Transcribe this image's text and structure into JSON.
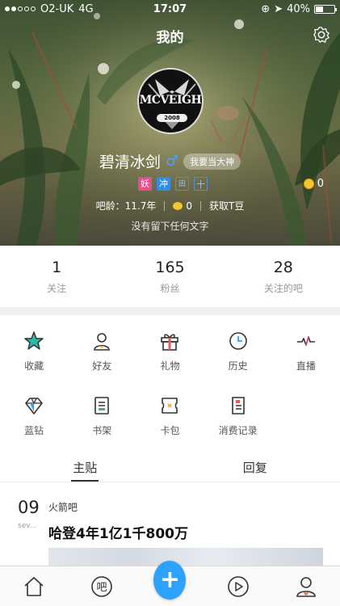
{
  "status_bar": {
    "carrier": "O2-UK",
    "network": "4G",
    "time": "17:07",
    "battery": "40%",
    "battery_level": 0.4
  },
  "header": {
    "title": "我的",
    "settings_icon": "settings-gear-icon"
  },
  "profile": {
    "avatar_text": "MCVEIGH",
    "avatar_year": "2008",
    "username": "碧清冰剑",
    "gender_symbol": "♂",
    "god_badge": "我要当大神",
    "medals": [
      "妖",
      "冲",
      "田",
      "十"
    ],
    "coin_count": "0",
    "bar_age": "吧龄：11.7年",
    "t_bean_count": "0",
    "get_t_bean": "获取T豆",
    "bio": "没有留下任何文字"
  },
  "stats": [
    {
      "value": "1",
      "label": "关注"
    },
    {
      "value": "165",
      "label": "粉丝"
    },
    {
      "value": "28",
      "label": "关注的吧"
    }
  ],
  "grid": [
    {
      "label": "收藏",
      "icon": "star-icon"
    },
    {
      "label": "好友",
      "icon": "friend-icon"
    },
    {
      "label": "礼物",
      "icon": "gift-icon"
    },
    {
      "label": "历史",
      "icon": "clock-icon"
    },
    {
      "label": "直播",
      "icon": "pulse-icon"
    },
    {
      "label": "蓝钻",
      "icon": "diamond-icon"
    },
    {
      "label": "书架",
      "icon": "bookshelf-icon"
    },
    {
      "label": "卡包",
      "icon": "card-icon"
    },
    {
      "label": "消费记录",
      "icon": "receipt-icon"
    }
  ],
  "tabs": [
    {
      "label": "主贴",
      "active": true
    },
    {
      "label": "回复",
      "active": false
    }
  ],
  "post": {
    "day": "09",
    "month": "sev...",
    "forum": "火箭吧",
    "title": "哈登4年1亿1千800万"
  },
  "bottom_nav": [
    {
      "name": "home",
      "icon": "home-icon"
    },
    {
      "name": "bar",
      "icon": "bar-icon",
      "label": "吧"
    },
    {
      "name": "post",
      "icon": "plus-icon",
      "label": "+"
    },
    {
      "name": "video",
      "icon": "play-icon"
    },
    {
      "name": "me",
      "icon": "profile-icon"
    }
  ],
  "colors": {
    "accent": "#2ea1ff",
    "gender": "#4aa3ff",
    "coin": "#f7c62f"
  }
}
